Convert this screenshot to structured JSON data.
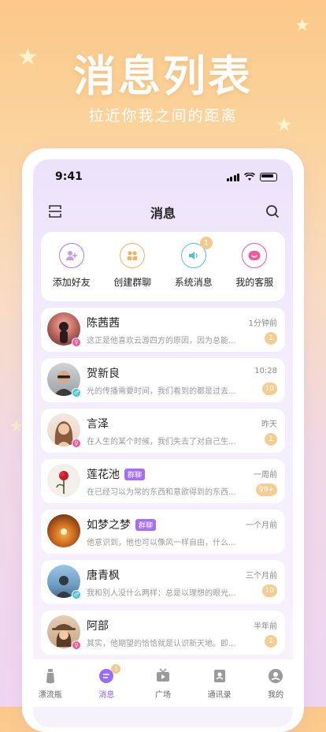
{
  "promo": {
    "title": "消息列表",
    "subtitle": "拉近你我之间的距离"
  },
  "status_bar": {
    "time": "9:41"
  },
  "header": {
    "title": "消息",
    "left_icon": "scan-icon",
    "right_icon": "search-icon"
  },
  "quick_actions": [
    {
      "label": "添加好友",
      "icon": "add-friend-icon",
      "color": "#b07be0"
    },
    {
      "label": "创建群聊",
      "icon": "group-icon",
      "color": "#f1b463"
    },
    {
      "label": "系统消息",
      "icon": "speaker-icon",
      "color": "#4cc3d9",
      "badge": "1"
    },
    {
      "label": "我的客服",
      "icon": "support-icon",
      "color": "#f05a9b"
    }
  ],
  "conversations": [
    {
      "name": "陈茜茜",
      "time": "1分钟前",
      "preview": "这正是他喜欢云游四方的原因，因为总能...",
      "badge": "1",
      "tag": "",
      "gender": "female"
    },
    {
      "name": "贺新良",
      "time": "10:28",
      "preview": "光的传播需要时间，我们看到的都是过去...",
      "badge": "10",
      "tag": "",
      "gender": "male"
    },
    {
      "name": "言泽",
      "time": "昨天",
      "preview": "在人生的某个时候，我们失去了对自己生...",
      "badge": "1",
      "tag": "",
      "gender": "female"
    },
    {
      "name": "莲花池",
      "time": "一周前",
      "preview": "在已经习以为常的东西和意欲得到的东西...",
      "badge": "99+",
      "tag": "群聊",
      "gender": ""
    },
    {
      "name": "如梦之梦",
      "time": "一个月前",
      "preview": "他意识到，他也可以像风一样自由，什么...",
      "badge": "",
      "tag": "群聊",
      "gender": ""
    },
    {
      "name": "唐青枫",
      "time": "三个月前",
      "preview": "我和别人没什么两样：总是以理想的眼光...",
      "badge": "10",
      "tag": "",
      "gender": "male"
    },
    {
      "name": "阿部",
      "time": "半年前",
      "preview": "其实，他期望的恰恰就是认识新天地。即...",
      "badge": "1",
      "tag": "",
      "gender": "female"
    }
  ],
  "tabbar": [
    {
      "label": "漂流瓶",
      "icon": "bottle-icon",
      "active": false
    },
    {
      "label": "消息",
      "icon": "message-icon",
      "active": true,
      "badge": "1"
    },
    {
      "label": "广场",
      "icon": "square-icon",
      "active": false
    },
    {
      "label": "通讯录",
      "icon": "contacts-icon",
      "active": false
    },
    {
      "label": "我的",
      "icon": "profile-icon",
      "active": false
    }
  ],
  "colors": {
    "accent": "#8b5cf6",
    "badge": "#f5cc91",
    "tag": "#a56ef3",
    "female": "#f05a9b",
    "male": "#4cc3d9"
  }
}
